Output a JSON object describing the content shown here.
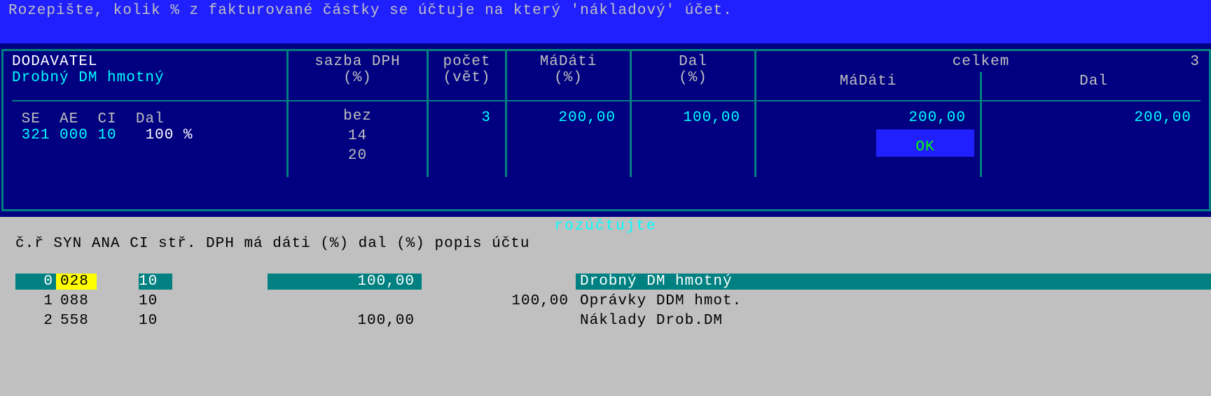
{
  "banner": "Rozepište, kolik % z fakturované částky se účtuje na který 'nákladový' účet.",
  "panel": {
    "supplier_label": "DODAVATEL",
    "supplier_name": "Drobný DM hmotný",
    "se_label": "SE",
    "ae_label": "AE",
    "ci_label": "CI",
    "dal_label": "Dal",
    "se_val": "321",
    "ae_val": "000",
    "ci_val": "10",
    "dal_pct": "100 %",
    "dph_h1": "sazba DPH",
    "dph_h2": "(%)",
    "dph_v1": "bez",
    "dph_v2": "14",
    "dph_v3": "20",
    "pocet_h1": "počet",
    "pocet_h2": "(vět)",
    "pocet_val": "3",
    "madati_h1": "MáDáti",
    "madati_h2": "(%)",
    "madati_val": "200,00",
    "dal_h1": "Dal",
    "dal_h2": "(%)",
    "dal_val": "100,00",
    "celkem_h": "celkem",
    "celkem_r": "3",
    "celkem_md_h": "MáDáti",
    "celkem_dal_h": "Dal",
    "celkem_md_val": "200,00",
    "celkem_dal_val": "200,00",
    "ok": "OK"
  },
  "bottom": {
    "rozuctujte": "rozúčtujte",
    "header": "č.ř SYN  ANA  CI  stř.  DPH  má dáti (%)   dal      (%)   popis účtu",
    "rows": [
      {
        "cr": "0",
        "syn": "028",
        "ana": "",
        "ci": "10",
        "str": "",
        "dph": "",
        "md": "100,00",
        "dl": "",
        "desc": "Drobný DM hmotný",
        "selected": true
      },
      {
        "cr": "1",
        "syn": "088",
        "ana": "",
        "ci": "10",
        "str": "",
        "dph": "",
        "md": "",
        "dl": "100,00",
        "desc": "Oprávky DDM hmot.",
        "selected": false
      },
      {
        "cr": "2",
        "syn": "558",
        "ana": "",
        "ci": "10",
        "str": "",
        "dph": "",
        "md": "100,00",
        "dl": "",
        "desc": "Náklady Drob.DM",
        "selected": false
      }
    ]
  }
}
